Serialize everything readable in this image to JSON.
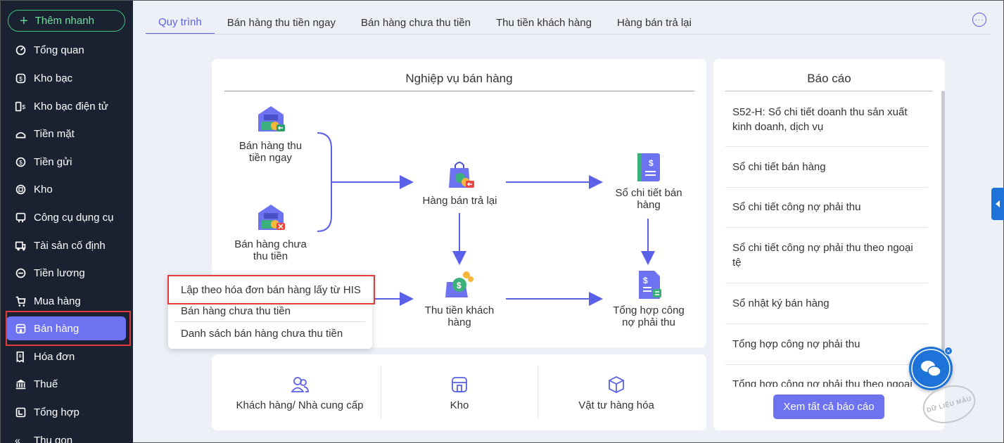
{
  "sidebar": {
    "quick_add": "Thêm nhanh",
    "items": [
      {
        "label": "Tổng quan",
        "icon": "dashboard-icon"
      },
      {
        "label": "Kho bạc",
        "icon": "treasury-icon"
      },
      {
        "label": "Kho bạc điện tử",
        "icon": "e-treasury-icon"
      },
      {
        "label": "Tiền mặt",
        "icon": "cash-icon"
      },
      {
        "label": "Tiền gửi",
        "icon": "deposit-icon"
      },
      {
        "label": "Kho",
        "icon": "warehouse-icon"
      },
      {
        "label": "Công cụ dụng cụ",
        "icon": "tools-icon"
      },
      {
        "label": "Tài sản cố định",
        "icon": "truck-icon"
      },
      {
        "label": "Tiền lương",
        "icon": "salary-icon"
      },
      {
        "label": "Mua hàng",
        "icon": "cart-icon"
      },
      {
        "label": "Bán hàng",
        "icon": "store-icon"
      },
      {
        "label": "Hóa đơn",
        "icon": "invoice-icon"
      },
      {
        "label": "Thuế",
        "icon": "bank-icon"
      },
      {
        "label": "Tổng hợp",
        "icon": "summary-icon"
      }
    ],
    "collapse": "Thu gọn"
  },
  "tabs": [
    "Quy trình",
    "Bán hàng thu tiền ngay",
    "Bán hàng chưa thu tiền",
    "Thu tiền khách hàng",
    "Hàng bán trả lại"
  ],
  "process": {
    "title": "Nghiệp vụ bán hàng",
    "nodes": {
      "cash_sale": "Bán hàng thu tiền ngay",
      "credit_sale": "Bán hàng chưa thu tiền",
      "returns": "Hàng bán trả lại",
      "ledger": "Sổ chi tiết bán hàng",
      "collect": "Thu tiền khách hàng",
      "debt_summary": "Tổng hợp công nợ phải thu"
    }
  },
  "dropdown": {
    "items": [
      "Lập theo hóa đơn bán hàng lấy từ HIS",
      "Bán hàng chưa thu tiền",
      "Danh sách bán hàng chưa thu tiền"
    ]
  },
  "bottom": {
    "items": [
      {
        "label": "Khách hàng/ Nhà cung cấp",
        "icon": "users-icon"
      },
      {
        "label": "Kho",
        "icon": "store-icon"
      },
      {
        "label": "Vật tư hàng hóa",
        "icon": "box-icon"
      }
    ]
  },
  "reports": {
    "title": "Báo cáo",
    "items": [
      "S52-H: Sổ chi tiết doanh thu sản xuất kinh doanh, dịch vụ",
      "Sổ chi tiết bán hàng",
      "Sổ chi tiết công nợ phải thu",
      "Sổ chi tiết công nợ phải thu theo ngoại tệ",
      "Sổ nhật ký bán hàng",
      "Tổng hợp công nợ phải thu",
      "Tổng hợp công nợ phải thu theo ngoại"
    ],
    "view_all": "Xem tất cả báo cáo"
  },
  "watermark": "DỮ LIỆU MẪU",
  "colors": {
    "accent": "#6c72f0",
    "sidebar_bg": "#1a2232",
    "highlight": "#e23a3a",
    "arrow": "#5a60e8"
  }
}
